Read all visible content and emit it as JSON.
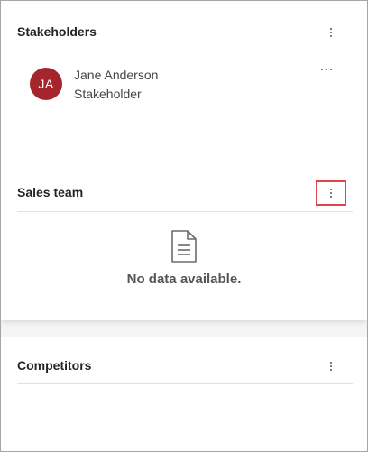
{
  "stakeholders": {
    "title": "Stakeholders",
    "members": [
      {
        "initials": "JA",
        "name": "Jane Anderson",
        "role": "Stakeholder"
      }
    ]
  },
  "sales_team": {
    "title": "Sales team",
    "empty_message": "No data available."
  },
  "competitors": {
    "title": "Competitors"
  },
  "colors": {
    "avatar": "#a4262c",
    "highlight_border": "#e0454b"
  },
  "icons": {
    "section_menu": "more-vertical-icon",
    "member_menu": "more-horizontal-icon",
    "empty_state": "document-icon"
  }
}
